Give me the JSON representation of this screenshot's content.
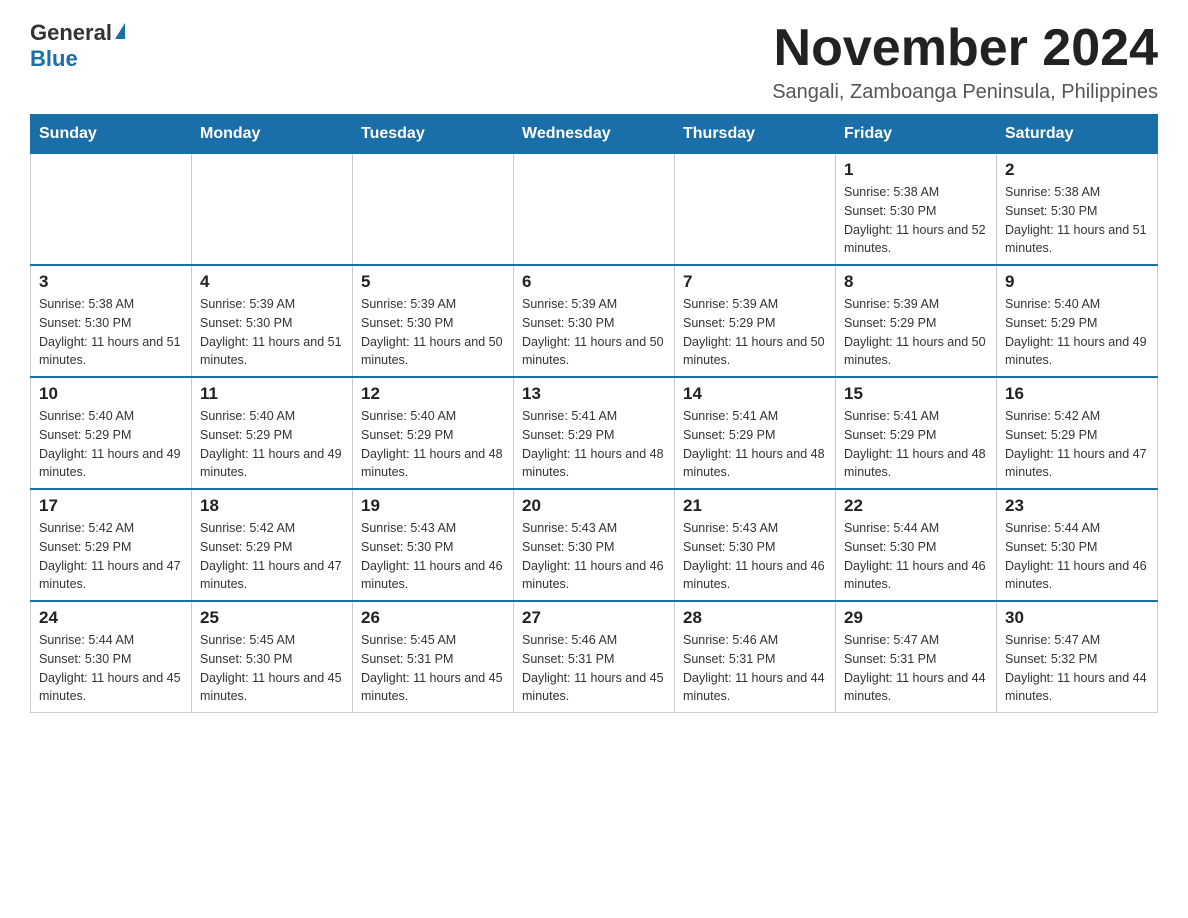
{
  "logo": {
    "general": "General",
    "blue": "Blue"
  },
  "header": {
    "title": "November 2024",
    "location": "Sangali, Zamboanga Peninsula, Philippines"
  },
  "weekdays": [
    "Sunday",
    "Monday",
    "Tuesday",
    "Wednesday",
    "Thursday",
    "Friday",
    "Saturday"
  ],
  "weeks": [
    [
      {
        "day": "",
        "sunrise": "",
        "sunset": "",
        "daylight": ""
      },
      {
        "day": "",
        "sunrise": "",
        "sunset": "",
        "daylight": ""
      },
      {
        "day": "",
        "sunrise": "",
        "sunset": "",
        "daylight": ""
      },
      {
        "day": "",
        "sunrise": "",
        "sunset": "",
        "daylight": ""
      },
      {
        "day": "",
        "sunrise": "",
        "sunset": "",
        "daylight": ""
      },
      {
        "day": "1",
        "sunrise": "Sunrise: 5:38 AM",
        "sunset": "Sunset: 5:30 PM",
        "daylight": "Daylight: 11 hours and 52 minutes."
      },
      {
        "day": "2",
        "sunrise": "Sunrise: 5:38 AM",
        "sunset": "Sunset: 5:30 PM",
        "daylight": "Daylight: 11 hours and 51 minutes."
      }
    ],
    [
      {
        "day": "3",
        "sunrise": "Sunrise: 5:38 AM",
        "sunset": "Sunset: 5:30 PM",
        "daylight": "Daylight: 11 hours and 51 minutes."
      },
      {
        "day": "4",
        "sunrise": "Sunrise: 5:39 AM",
        "sunset": "Sunset: 5:30 PM",
        "daylight": "Daylight: 11 hours and 51 minutes."
      },
      {
        "day": "5",
        "sunrise": "Sunrise: 5:39 AM",
        "sunset": "Sunset: 5:30 PM",
        "daylight": "Daylight: 11 hours and 50 minutes."
      },
      {
        "day": "6",
        "sunrise": "Sunrise: 5:39 AM",
        "sunset": "Sunset: 5:30 PM",
        "daylight": "Daylight: 11 hours and 50 minutes."
      },
      {
        "day": "7",
        "sunrise": "Sunrise: 5:39 AM",
        "sunset": "Sunset: 5:29 PM",
        "daylight": "Daylight: 11 hours and 50 minutes."
      },
      {
        "day": "8",
        "sunrise": "Sunrise: 5:39 AM",
        "sunset": "Sunset: 5:29 PM",
        "daylight": "Daylight: 11 hours and 50 minutes."
      },
      {
        "day": "9",
        "sunrise": "Sunrise: 5:40 AM",
        "sunset": "Sunset: 5:29 PM",
        "daylight": "Daylight: 11 hours and 49 minutes."
      }
    ],
    [
      {
        "day": "10",
        "sunrise": "Sunrise: 5:40 AM",
        "sunset": "Sunset: 5:29 PM",
        "daylight": "Daylight: 11 hours and 49 minutes."
      },
      {
        "day": "11",
        "sunrise": "Sunrise: 5:40 AM",
        "sunset": "Sunset: 5:29 PM",
        "daylight": "Daylight: 11 hours and 49 minutes."
      },
      {
        "day": "12",
        "sunrise": "Sunrise: 5:40 AM",
        "sunset": "Sunset: 5:29 PM",
        "daylight": "Daylight: 11 hours and 48 minutes."
      },
      {
        "day": "13",
        "sunrise": "Sunrise: 5:41 AM",
        "sunset": "Sunset: 5:29 PM",
        "daylight": "Daylight: 11 hours and 48 minutes."
      },
      {
        "day": "14",
        "sunrise": "Sunrise: 5:41 AM",
        "sunset": "Sunset: 5:29 PM",
        "daylight": "Daylight: 11 hours and 48 minutes."
      },
      {
        "day": "15",
        "sunrise": "Sunrise: 5:41 AM",
        "sunset": "Sunset: 5:29 PM",
        "daylight": "Daylight: 11 hours and 48 minutes."
      },
      {
        "day": "16",
        "sunrise": "Sunrise: 5:42 AM",
        "sunset": "Sunset: 5:29 PM",
        "daylight": "Daylight: 11 hours and 47 minutes."
      }
    ],
    [
      {
        "day": "17",
        "sunrise": "Sunrise: 5:42 AM",
        "sunset": "Sunset: 5:29 PM",
        "daylight": "Daylight: 11 hours and 47 minutes."
      },
      {
        "day": "18",
        "sunrise": "Sunrise: 5:42 AM",
        "sunset": "Sunset: 5:29 PM",
        "daylight": "Daylight: 11 hours and 47 minutes."
      },
      {
        "day": "19",
        "sunrise": "Sunrise: 5:43 AM",
        "sunset": "Sunset: 5:30 PM",
        "daylight": "Daylight: 11 hours and 46 minutes."
      },
      {
        "day": "20",
        "sunrise": "Sunrise: 5:43 AM",
        "sunset": "Sunset: 5:30 PM",
        "daylight": "Daylight: 11 hours and 46 minutes."
      },
      {
        "day": "21",
        "sunrise": "Sunrise: 5:43 AM",
        "sunset": "Sunset: 5:30 PM",
        "daylight": "Daylight: 11 hours and 46 minutes."
      },
      {
        "day": "22",
        "sunrise": "Sunrise: 5:44 AM",
        "sunset": "Sunset: 5:30 PM",
        "daylight": "Daylight: 11 hours and 46 minutes."
      },
      {
        "day": "23",
        "sunrise": "Sunrise: 5:44 AM",
        "sunset": "Sunset: 5:30 PM",
        "daylight": "Daylight: 11 hours and 46 minutes."
      }
    ],
    [
      {
        "day": "24",
        "sunrise": "Sunrise: 5:44 AM",
        "sunset": "Sunset: 5:30 PM",
        "daylight": "Daylight: 11 hours and 45 minutes."
      },
      {
        "day": "25",
        "sunrise": "Sunrise: 5:45 AM",
        "sunset": "Sunset: 5:30 PM",
        "daylight": "Daylight: 11 hours and 45 minutes."
      },
      {
        "day": "26",
        "sunrise": "Sunrise: 5:45 AM",
        "sunset": "Sunset: 5:31 PM",
        "daylight": "Daylight: 11 hours and 45 minutes."
      },
      {
        "day": "27",
        "sunrise": "Sunrise: 5:46 AM",
        "sunset": "Sunset: 5:31 PM",
        "daylight": "Daylight: 11 hours and 45 minutes."
      },
      {
        "day": "28",
        "sunrise": "Sunrise: 5:46 AM",
        "sunset": "Sunset: 5:31 PM",
        "daylight": "Daylight: 11 hours and 44 minutes."
      },
      {
        "day": "29",
        "sunrise": "Sunrise: 5:47 AM",
        "sunset": "Sunset: 5:31 PM",
        "daylight": "Daylight: 11 hours and 44 minutes."
      },
      {
        "day": "30",
        "sunrise": "Sunrise: 5:47 AM",
        "sunset": "Sunset: 5:32 PM",
        "daylight": "Daylight: 11 hours and 44 minutes."
      }
    ]
  ],
  "colors": {
    "header_bg": "#1a6fa8",
    "header_text": "#ffffff",
    "border": "#cccccc"
  }
}
